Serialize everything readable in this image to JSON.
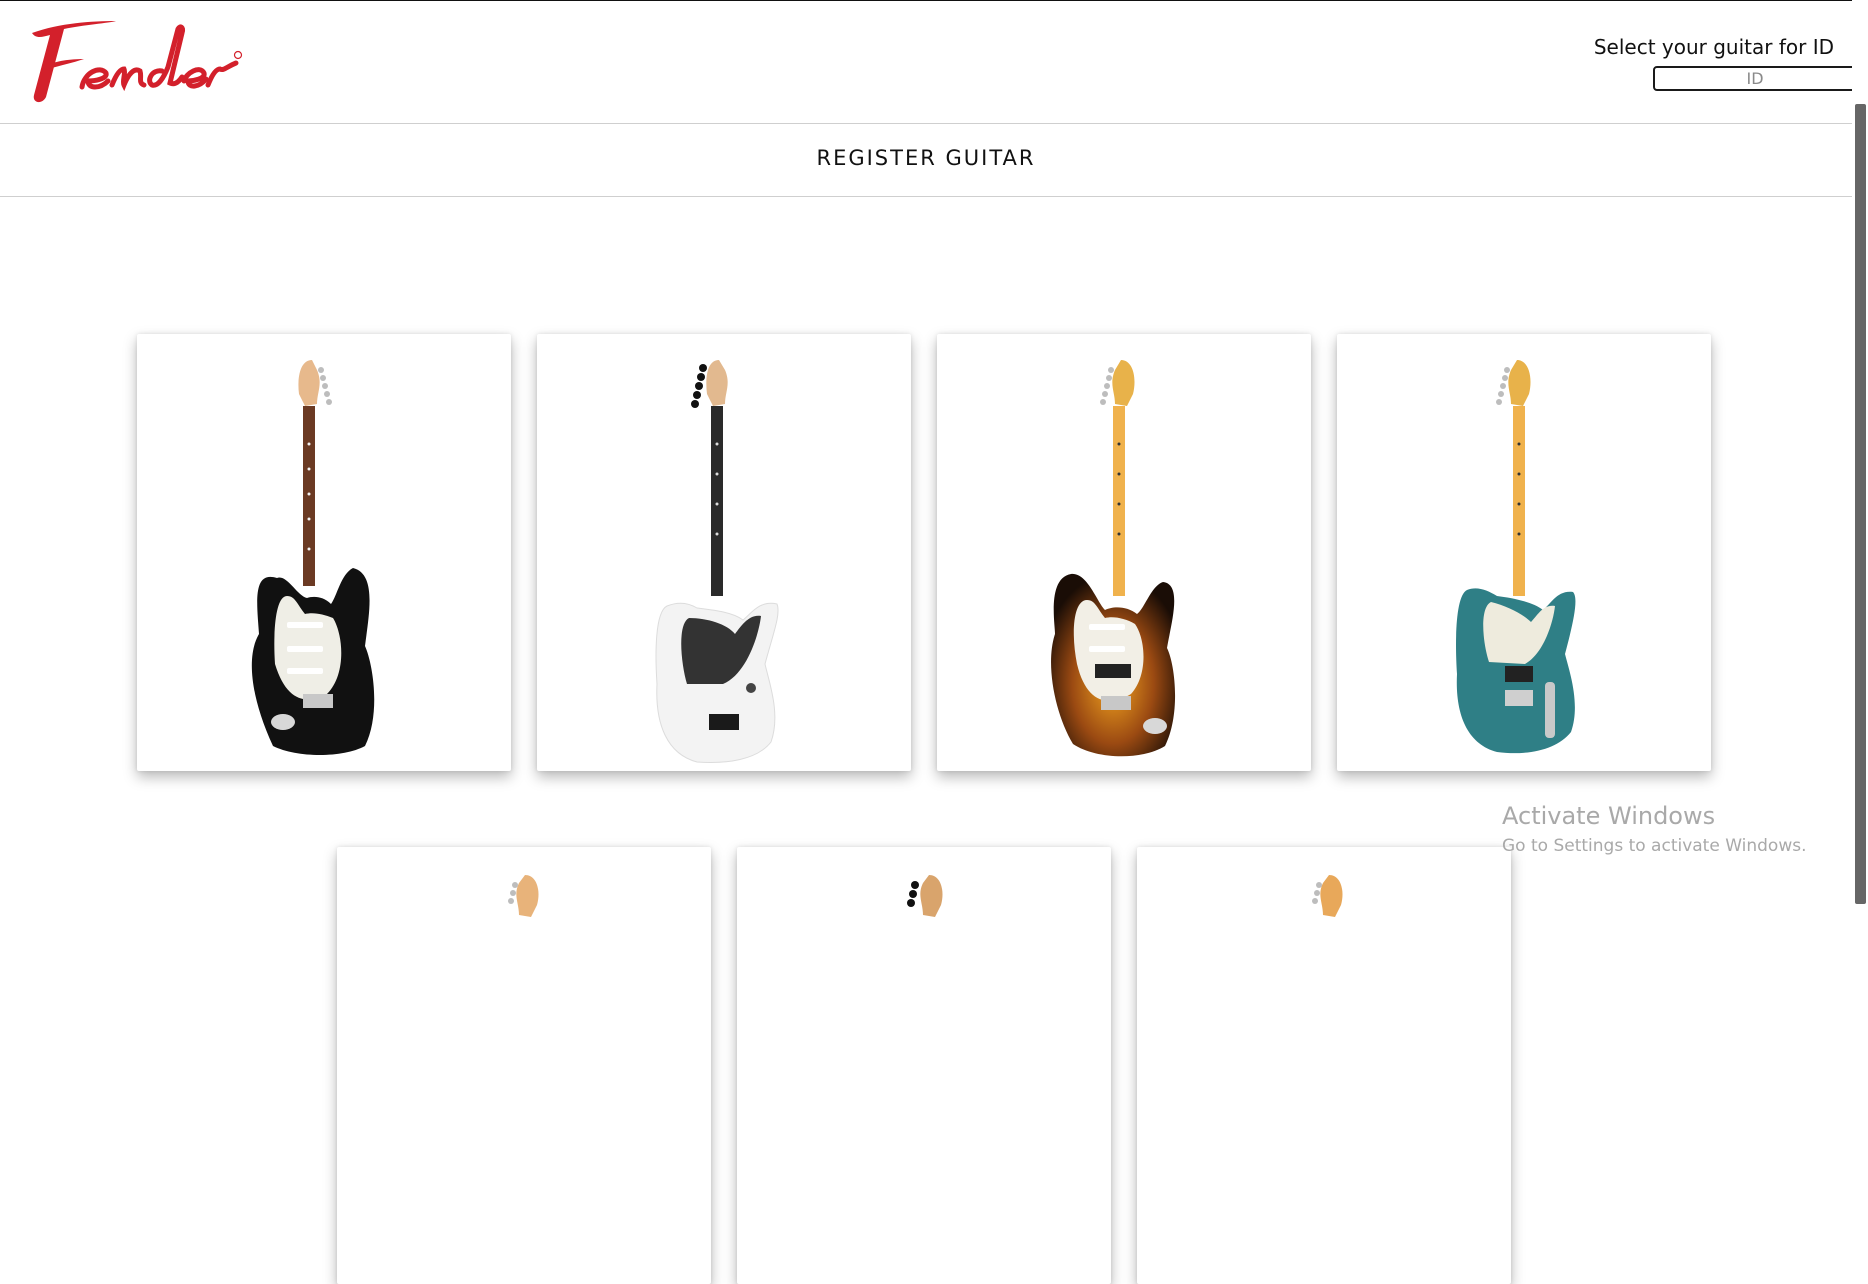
{
  "brand": {
    "name": "Fender",
    "color": "#d3202b"
  },
  "id_search": {
    "label": "Select your guitar for ID",
    "placeholder": "ID",
    "value": "",
    "icon": "search-icon"
  },
  "nav": {
    "register_label": "REGISTER GUITAR"
  },
  "guitars": [
    {
      "style": "stratocaster-left-handed",
      "body": "#111111",
      "neck": "rosewood",
      "pickguard": "#efeee6"
    },
    {
      "style": "telecaster-jim-root",
      "body": "#f3f3f3",
      "neck": "ebony",
      "pickguard": "#333333"
    },
    {
      "style": "stratocaster-hss",
      "body": "sunburst",
      "neck": "maple",
      "pickguard": "#f2efe6"
    },
    {
      "style": "telecaster-hh",
      "body": "#2f7f86",
      "neck": "maple",
      "pickguard": "#eeebdd"
    },
    {
      "style": "stratocaster"
    },
    {
      "style": "telecaster"
    },
    {
      "style": "stratocaster"
    }
  ],
  "watermark": {
    "title": "Activate Windows",
    "subtitle": "Go to Settings to activate Windows."
  }
}
